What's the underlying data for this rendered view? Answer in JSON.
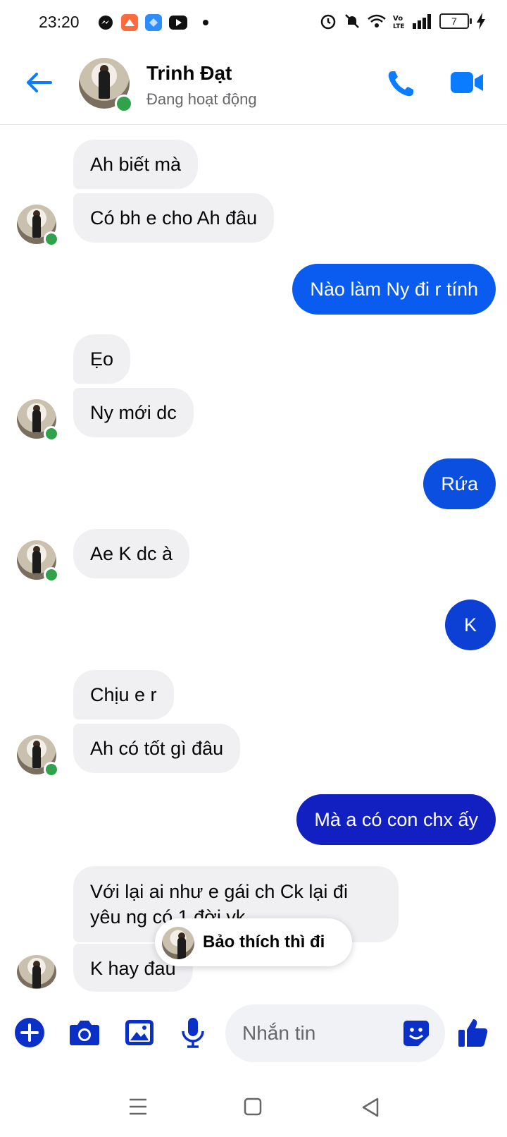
{
  "status_bar": {
    "time": "23:20",
    "battery": "7",
    "icons": [
      "messenger-icon",
      "app-icon",
      "shield-icon",
      "youtube-icon",
      "alarm-icon",
      "mute-icon",
      "wifi-icon",
      "volte-icon",
      "signal-icon",
      "charging-icon"
    ]
  },
  "header": {
    "name": "Trinh Đạt",
    "status": "Đang hoạt động"
  },
  "messages": [
    {
      "side": "in",
      "text": "Ah biết mà"
    },
    {
      "side": "in",
      "text": "Có bh e cho Ah đâu"
    },
    {
      "side": "out",
      "text": "Nào làm Ny đi r tính"
    },
    {
      "side": "in",
      "text": "Ẹo"
    },
    {
      "side": "in",
      "text": "Ny mới dc"
    },
    {
      "side": "out",
      "text": "Rứa"
    },
    {
      "side": "in",
      "text": "Ae K dc à"
    },
    {
      "side": "out",
      "text": "K"
    },
    {
      "side": "in",
      "text": "Chịu e r"
    },
    {
      "side": "in",
      "text": "Ah có tốt gì đâu"
    },
    {
      "side": "out",
      "text": "Mà a có con chx ấy"
    },
    {
      "side": "in",
      "text": "Với lại ai như e gái ch Ck lại đi yêu ng có 1 đời vk"
    },
    {
      "side": "in",
      "text": "K hay đau"
    }
  ],
  "toast": {
    "text": "Bảo thích thì đi"
  },
  "composer": {
    "placeholder": "Nhắn tin"
  },
  "colors": {
    "accent": "#0a7cff",
    "outgoing_top": "#0a5cf0",
    "outgoing_bottom": "#1a1fb8",
    "incoming": "#f0f0f3",
    "online": "#31a24c"
  }
}
